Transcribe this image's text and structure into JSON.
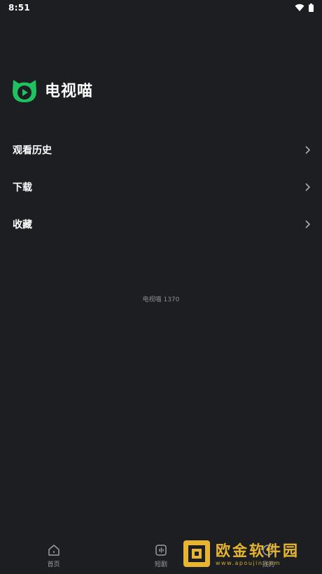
{
  "status_bar": {
    "time": "8:51",
    "icons": [
      "wifi-icon",
      "battery-icon"
    ]
  },
  "brand": {
    "name": "电视喵",
    "logo_icon": "cat-play-logo-icon"
  },
  "menu": {
    "items": [
      {
        "label": "观看历史"
      },
      {
        "label": "下载"
      },
      {
        "label": "收藏"
      }
    ]
  },
  "version": "电视喵 1370",
  "bottom_nav": {
    "tabs": [
      {
        "label": "首页",
        "icon": "home-icon"
      },
      {
        "label": "短剧",
        "icon": "short-drama-icon"
      },
      {
        "label": "我的",
        "icon": "profile-icon"
      }
    ]
  },
  "watermark": {
    "text": "欧金软件园",
    "url": "www.apoujin.com"
  },
  "colors": {
    "background": "#1c1e22",
    "brand_green": "#1fc25e",
    "watermark_gold": "#e8b531"
  }
}
